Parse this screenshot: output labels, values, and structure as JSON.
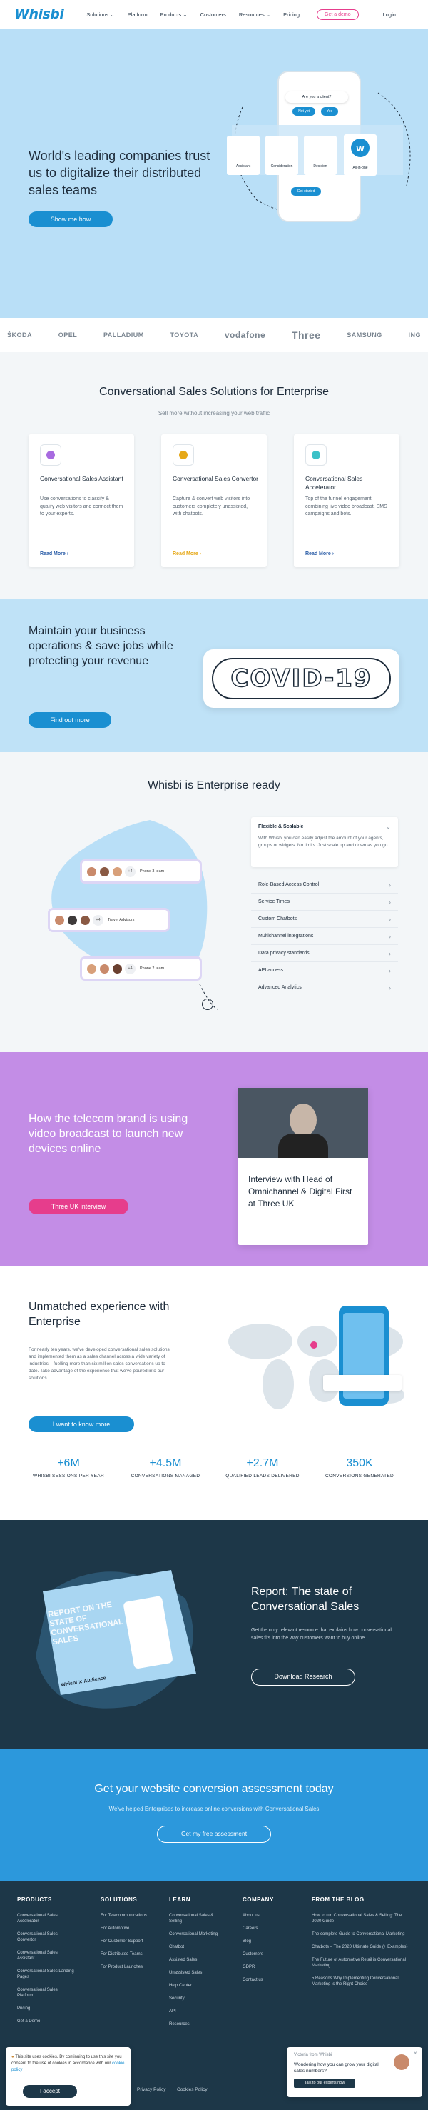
{
  "nav": {
    "logo": "Whisbi",
    "links": [
      "Solutions",
      "Platform",
      "Products",
      "Customers",
      "Resources",
      "Pricing"
    ],
    "demo": "Get a demo",
    "login": "Login"
  },
  "hero": {
    "title": "World's leading companies trust us to digitalize their distributed sales teams",
    "cta": "Show me how",
    "bubble": "Are you a client?",
    "opt_yes": "Not yet",
    "opt_no": "Yes",
    "opt_icons": [
      "Assistant",
      "Consideration",
      "Decision",
      "All-in-one"
    ],
    "get_started": "Get started"
  },
  "logos": [
    "ŠKODA",
    "OPEL",
    "PALLADIUM",
    "TOYOTA",
    "vodafone",
    "Three",
    "SAMSUNG",
    "ING"
  ],
  "solutions": {
    "title": "Conversational Sales Solutions for Enterprise",
    "subtitle": "Sell more without increasing your web traffic",
    "cards": [
      {
        "title": "Conversational Sales Assistant",
        "text": "Use conversations to classify & qualify web visitors and connect them to your experts.",
        "more": "Read More ›",
        "color": "#2c5ea8",
        "icon_color": "#a86be0"
      },
      {
        "title": "Conversational Sales Convertor",
        "text": "Capture & convert web visitors into customers completely unassisted, with chatbots.",
        "more": "Read More ›",
        "color": "#e6a817",
        "icon_color": "#e6a817"
      },
      {
        "title": "Conversational Sales Accelerator",
        "text": "Top of the funnel engagement combining live video broadcast, SMS campaigns and bots.",
        "more": "Read More ›",
        "color": "#2c5ea8",
        "icon_color": "#3cc1c7"
      }
    ]
  },
  "covid": {
    "title": "Maintain your business operations & save jobs while protecting your revenue",
    "cta": "Find out more",
    "badge": "COVID-19"
  },
  "enterprise": {
    "title": "Whisbi is Enterprise ready",
    "open_title": "Flexible & Scalable",
    "open_text": "With Whisbi you can easily adjust the amount of your agents, groups or widgets. No limits. Just scale up and down as you go.",
    "features": [
      "Role-Based Access Control",
      "Service Times",
      "Custom Chatbots",
      "Multichannel integrations",
      "Data privacy standards",
      "API access",
      "Advanced Analytics"
    ],
    "teams": [
      "Phone 3 team",
      "Travel Advisors",
      "Phone 2 team"
    ],
    "plus": "+4"
  },
  "telecom": {
    "title": "How the telecom brand is using video broadcast to launch new devices online",
    "cta": "Three UK interview",
    "card_text": "Interview with Head of Omnichannel & Digital First at Three UK"
  },
  "unmatched": {
    "title": "Unmatched experience with Enterprise",
    "text": "For nearly ten years, we've developed conversational sales solutions and implemented them as a sales channel across a wide variety of industries – fuelling more than six million sales conversations up to date. Take advantage of the experience that we've poured into our solutions.",
    "cta": "I want to know more",
    "stats": [
      {
        "num": "+6M",
        "label": "WHISBI SESSIONS PER YEAR"
      },
      {
        "num": "+4.5M",
        "label": "CONVERSATIONS MANAGED"
      },
      {
        "num": "+2.7M",
        "label": "QUALIFIED LEADS DELIVERED"
      },
      {
        "num": "350K",
        "label": "CONVERSIONS GENERATED"
      }
    ]
  },
  "report": {
    "title": "Report: The state of Conversational Sales",
    "text": "Get the only relevant resource that explains how conversational sales fits into the way customers want to buy online.",
    "cta": "Download Research",
    "book_title": "REPORT ON THE STATE OF CONVERSATIONAL SALES",
    "book_brand": "Whisbi ⨯ Audience"
  },
  "assess": {
    "title": "Get your website conversion assessment today",
    "subtitle": "We've helped Enterprises to increase online conversions with Conversational Sales",
    "cta": "Get my free assessment"
  },
  "footer": {
    "cols": [
      {
        "title": "PRODUCTS",
        "items": [
          "Conversational Sales Accelerator",
          "Conversational Sales Convertor",
          "Conversational Sales Assistant",
          "Conversational Sales Landing Pages",
          "Conversational Sales Platform",
          "Pricing",
          "Get a Demo"
        ]
      },
      {
        "title": "SOLUTIONS",
        "items": [
          "For Telecommunications",
          "For Automotive",
          "For Customer Support",
          "For Distributed Teams",
          "For Product Launches"
        ]
      },
      {
        "title": "LEARN",
        "items": [
          "Conversational Sales & Selling",
          "Conversational Marketing",
          "Chatbot",
          "Assisted Sales",
          "Unassisted Sales",
          "Help Center",
          "Security",
          "API",
          "Resources"
        ]
      },
      {
        "title": "COMPANY",
        "items": [
          "About us",
          "Careers",
          "Blog",
          "Customers",
          "GDPR",
          "Contact us"
        ]
      },
      {
        "title": "FROM THE BLOG",
        "items": [
          "How to run Conversational Sales & Selling: The 2020 Guide",
          "The complete Guide to Conversational Marketing",
          "Chatbots – The 2020 Ultimate Guide (+ Examples)",
          "The Future of Automotive Retail is Conversational Marketing",
          "5 Reasons Why Implementing Conversational Marketing is the Right Choice"
        ]
      }
    ],
    "links": [
      "Privacy Policy",
      "Cookies Policy"
    ]
  },
  "cookie": {
    "text": "This site uses cookies. By continuing to use this site you consent to the use of cookies in accordance with our",
    "link": "cookie policy",
    "btn": "I accept"
  },
  "chat": {
    "name": "Victoria from Whisbi",
    "text": "Wondering how you can grow your digital sales numbers?",
    "btn": "Talk to our experts now"
  },
  "colors": {
    "blue": "#1a8fd1",
    "pink": "#e63d8c",
    "navy": "#1d3748"
  }
}
